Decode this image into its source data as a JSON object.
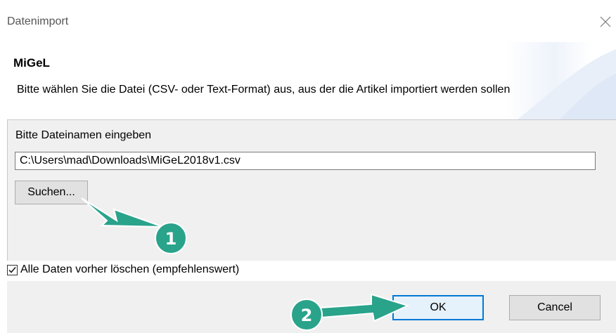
{
  "window": {
    "title": "Datenimport"
  },
  "header": {
    "title": "MiGeL",
    "description": "Bitte wählen Sie die Datei (CSV- oder Text-Format) aus, aus der die Artikel importiert werden sollen"
  },
  "file": {
    "label": "Bitte Dateinamen eingeben",
    "value": "C:\\Users\\mad\\Downloads\\MiGeL2018v1.csv"
  },
  "buttons": {
    "browse": "Suchen...",
    "ok": "OK",
    "cancel": "Cancel"
  },
  "options": {
    "delete_all": {
      "label": "Alle Daten vorher löschen (empfehlenswert)",
      "checked": true
    }
  },
  "annotations": {
    "step1": "1",
    "step2": "2",
    "color": "#2aa38b"
  },
  "icons": [
    "close-icon",
    "checkmark-icon"
  ]
}
